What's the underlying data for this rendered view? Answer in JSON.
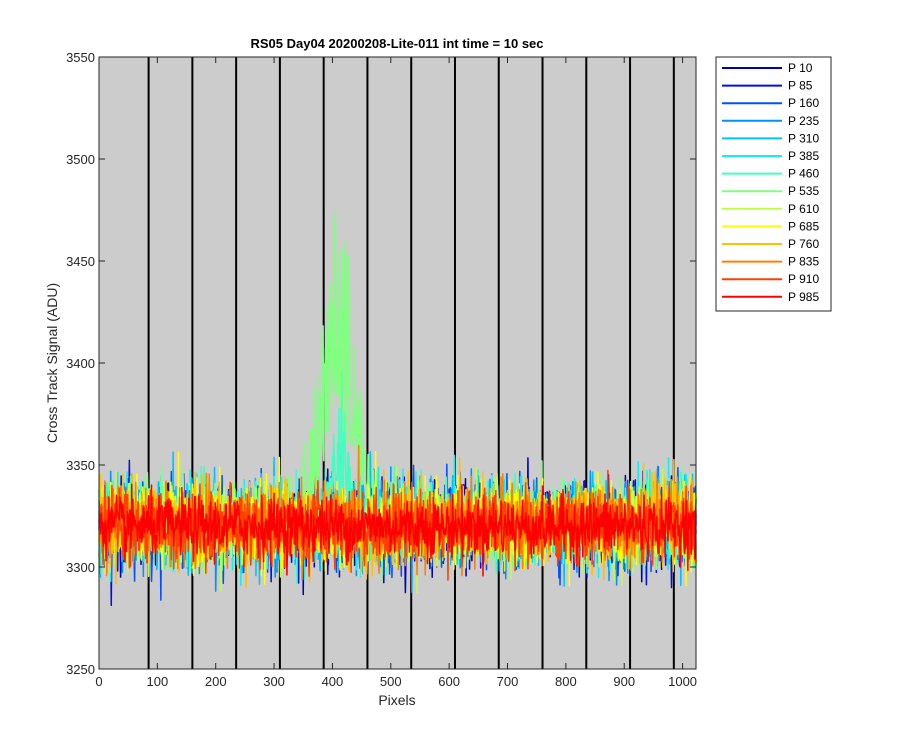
{
  "chart_data": {
    "type": "line",
    "title": "RS05 Day04 20200208-Lite-011 int time = 10 sec",
    "xlabel": "Pixels",
    "ylabel": "Cross Track Signal (ADU)",
    "xlim": [
      0,
      1023
    ],
    "ylim": [
      3250,
      3550
    ],
    "xticks": [
      0,
      100,
      200,
      300,
      400,
      500,
      600,
      700,
      800,
      900,
      1000
    ],
    "yticks": [
      3250,
      3300,
      3350,
      3400,
      3450,
      3500,
      3550
    ],
    "xtick_labels": [
      "0",
      "100",
      "200",
      "300",
      "400",
      "500",
      "600",
      "700",
      "800",
      "900",
      "1000"
    ],
    "ytick_labels": [
      "3250",
      "3300",
      "3350",
      "3400",
      "3450",
      "3500",
      "3550"
    ],
    "vertical_lines_x": [
      85,
      160,
      235,
      310,
      385,
      460,
      535,
      610,
      685,
      760,
      835,
      910,
      985
    ],
    "background_color": "#cccccc",
    "legend_position": "outside-top-right",
    "series": [
      {
        "name": "P 10",
        "color": "#0000b4",
        "baseline": 3321,
        "noise": 11
      },
      {
        "name": "P 85",
        "color": "#0010e0",
        "baseline": 3321,
        "noise": 11
      },
      {
        "name": "P 160",
        "color": "#0050ff",
        "baseline": 3321,
        "noise": 11
      },
      {
        "name": "P 235",
        "color": "#0090ff",
        "baseline": 3321,
        "noise": 11
      },
      {
        "name": "P 310",
        "color": "#00c0ff",
        "baseline": 3321,
        "noise": 11
      },
      {
        "name": "P 385",
        "color": "#10f0f0",
        "baseline": 3322,
        "noise": 11
      },
      {
        "name": "P 460",
        "color": "#40ffc0",
        "baseline": 3322,
        "noise": 11,
        "peak": {
          "center": 415,
          "width": 40,
          "height": 35
        }
      },
      {
        "name": "P 535",
        "color": "#80ff80",
        "baseline": 3322,
        "noise": 11,
        "peak": {
          "center": 410,
          "width": 65,
          "height": 120
        }
      },
      {
        "name": "P 610",
        "color": "#c0ff40",
        "baseline": 3321,
        "noise": 11
      },
      {
        "name": "P 685",
        "color": "#ffff00",
        "baseline": 3321,
        "noise": 11
      },
      {
        "name": "P 760",
        "color": "#ffc000",
        "baseline": 3321,
        "noise": 11
      },
      {
        "name": "P 835",
        "color": "#ff8000",
        "baseline": 3321,
        "noise": 10
      },
      {
        "name": "P 910",
        "color": "#ff4000",
        "baseline": 3320,
        "noise": 10
      },
      {
        "name": "P 985",
        "color": "#ff0000",
        "baseline": 3320,
        "noise": 8
      }
    ]
  }
}
